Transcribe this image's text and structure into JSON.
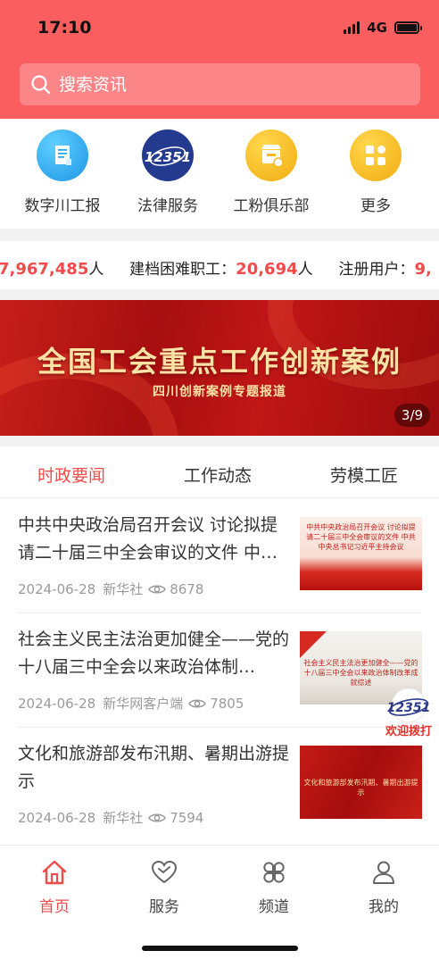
{
  "status": {
    "time": "17:10",
    "network": "4G"
  },
  "search": {
    "placeholder": "搜索资讯"
  },
  "quick_links": [
    {
      "label": "数字川工报",
      "icon": "newspaper-icon",
      "color": "#2aa6ef"
    },
    {
      "label": "法律服务",
      "icon": "12351-logo-icon",
      "color": "#2a3a8c",
      "logo_text": "12351"
    },
    {
      "label": "工粉俱乐部",
      "icon": "store-icon",
      "color": "#f5b820"
    },
    {
      "label": "更多",
      "icon": "grid-icon",
      "color": "#f5b820"
    }
  ],
  "ticker": {
    "value1": "7,967,485",
    "unit1": "人",
    "label2": "建档困难职工：",
    "value2": "20,694",
    "unit2": "人",
    "label3": "注册用户：",
    "value3": "9,"
  },
  "banner": {
    "title": "全国工会重点工作创新案例",
    "subtitle": "四川创新案例专题报道",
    "pager": "3/9"
  },
  "tabs": [
    {
      "label": "时政要闻",
      "active": true
    },
    {
      "label": "工作动态",
      "active": false
    },
    {
      "label": "劳模工匠",
      "active": false
    }
  ],
  "news": [
    {
      "title": "中共中央政治局召开会议 讨论拟提请二十届三中全会审议的文件 中…",
      "date": "2024-06-28",
      "source": "新华社",
      "views": "8678",
      "thumb_text": "中共中央政治局召开会议 讨论拟提请二十届三中全会审议的文件 中共中央总书记习近平主持会议"
    },
    {
      "title": "社会主义民主法治更加健全——党的十八届三中全会以来政治体制…",
      "date": "2024-06-28",
      "source": "新华网客户端",
      "views": "7805",
      "thumb_text": "社会主义民主法治更加健全——党的十八届三中全会以来政治体制改革成就综述"
    },
    {
      "title": "文化和旅游部发布汛期、暑期出游提示",
      "date": "2024-06-28",
      "source": "新华社",
      "views": "7594",
      "thumb_text": "文化和旅游部发布汛期、暑期出游提示"
    }
  ],
  "float_button": {
    "logo_text": "12351",
    "label": "欢迎拨打"
  },
  "tabbar": [
    {
      "label": "首页",
      "icon": "home-icon",
      "active": true
    },
    {
      "label": "服务",
      "icon": "heart-icon",
      "active": false
    },
    {
      "label": "频道",
      "icon": "channel-icon",
      "active": false
    },
    {
      "label": "我的",
      "icon": "user-icon",
      "active": false
    }
  ],
  "colors": {
    "brand": "#fb5e5f",
    "accent": "#f24b4b"
  }
}
